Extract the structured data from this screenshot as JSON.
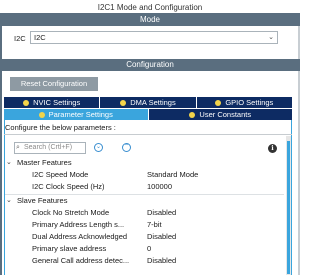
{
  "title": "I2C1 Mode and Configuration",
  "mode_section": {
    "header": "Mode",
    "field_label": "I2C",
    "field_value": "I2C"
  },
  "config_section": {
    "header": "Configuration",
    "reset_label": "Reset Configuration",
    "tabs_row1": [
      "NVIC Settings",
      "DMA Settings",
      "GPIO Settings"
    ],
    "tabs_row2": [
      "Parameter Settings",
      "User Constants"
    ],
    "active_tab": "Parameter Settings",
    "hint": "Configure the below parameters :",
    "search_placeholder": "Search (Crtl+F)"
  },
  "groups": [
    {
      "name": "Master Features",
      "params": [
        {
          "name": "I2C Speed Mode",
          "value": "Standard Mode"
        },
        {
          "name": "I2C Clock Speed (Hz)",
          "value": "100000"
        }
      ]
    },
    {
      "name": "Slave Features",
      "params": [
        {
          "name": "Clock No Stretch Mode",
          "value": "Disabled"
        },
        {
          "name": "Primary Address Length s...",
          "value": "7-bit"
        },
        {
          "name": "Dual Address Acknowledged",
          "value": "Disabled"
        },
        {
          "name": "Primary slave address",
          "value": "0"
        },
        {
          "name": "General Call address detec...",
          "value": "Disabled"
        }
      ]
    }
  ],
  "colors": {
    "section_bar": "#5a6e7f",
    "tab_dark": "#0d2b63",
    "tab_active": "#3aa5dd",
    "tab_dot": "#f3d44a"
  },
  "icons": {
    "search": "search-icon",
    "down": "chevron-down-icon",
    "info": "info-icon"
  }
}
